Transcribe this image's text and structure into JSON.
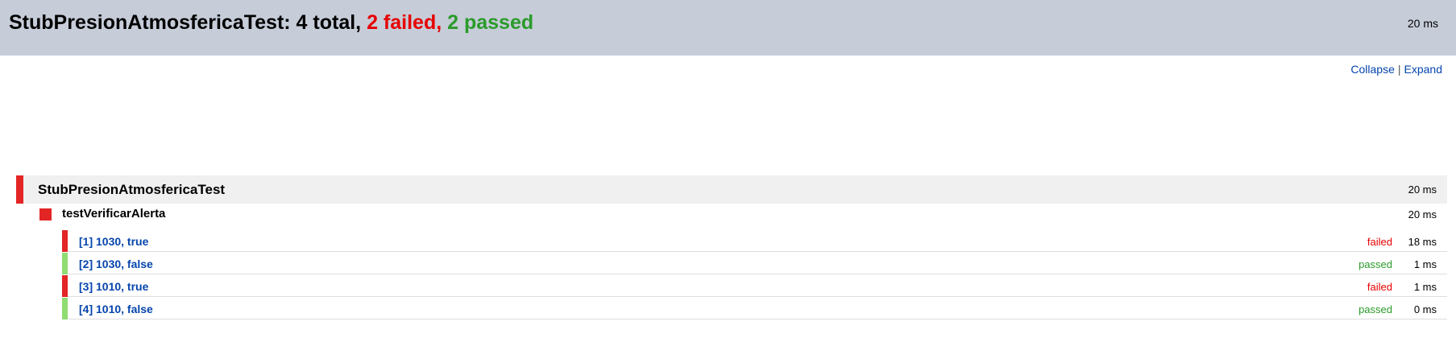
{
  "header": {
    "title_prefix": "StubPresionAtmosfericaTest: 4 total,",
    "failed_text": "2 failed,",
    "passed_text": "2 passed",
    "duration": "20 ms"
  },
  "controls": {
    "collapse_label": "Collapse",
    "separator": "|",
    "expand_label": "Expand"
  },
  "suite": {
    "name": "StubPresionAtmosfericaTest",
    "duration": "20 ms",
    "status": "failed"
  },
  "method": {
    "name": "testVerificarAlerta",
    "duration": "20 ms",
    "status": "failed"
  },
  "tests": [
    {
      "name": "[1] 1030, true",
      "status": "failed",
      "duration": "18 ms"
    },
    {
      "name": "[2] 1030, false",
      "status": "passed",
      "duration": "1 ms"
    },
    {
      "name": "[3] 1010, true",
      "status": "failed",
      "duration": "1 ms"
    },
    {
      "name": "[4] 1010, false",
      "status": "passed",
      "duration": "0 ms"
    }
  ],
  "colors": {
    "failed": "#e32525",
    "passed": "#8fdc72",
    "header_bg": "#c6ccd8",
    "link": "#0645ad"
  }
}
